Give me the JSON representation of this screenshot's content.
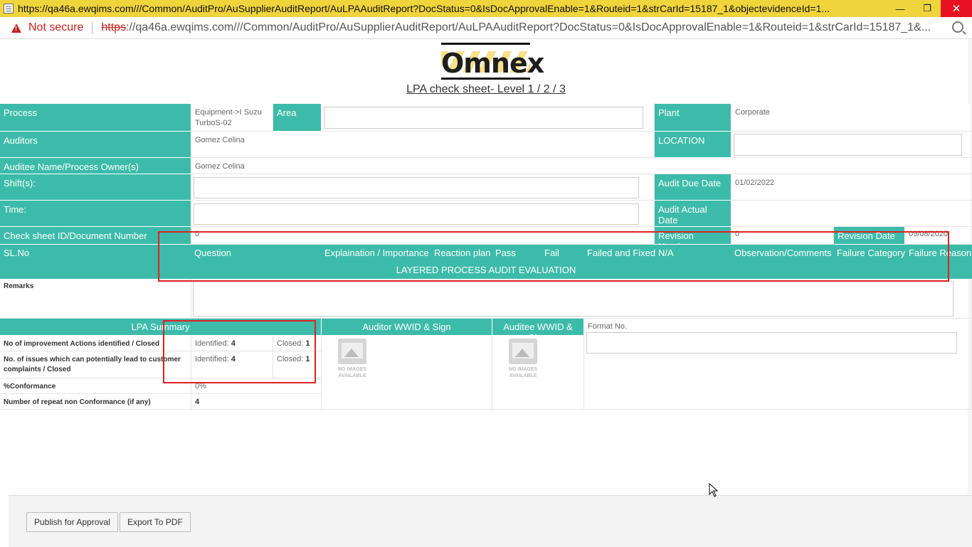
{
  "window": {
    "title": "https://qa46a.ewqims.com///Common/AuditPro/AuSupplierAuditReport/AuLPAAuditReport?DocStatus=0&IsDocApprovalEnable=1&Routeid=1&strCarId=15187_1&objectevidenceId=1...",
    "min_glyph": "—",
    "restore_glyph": "❐",
    "close_glyph": "✕"
  },
  "address": {
    "warning": "Not secure",
    "url_scheme": "https",
    "url_rest": "://qa46a.ewqims.com///Common/AuditPro/AuSupplierAuditReport/AuLPAAuditReport?DocStatus=0&IsDocApprovalEnable=1&Routeid=1&strCarId=15187_1&..."
  },
  "header": {
    "logo_text": "Omnex",
    "title": "LPA check sheet- Level 1 / 2 / 3"
  },
  "form": {
    "process_label": "Process",
    "process_value": "Equipment->I Suzu TurboS-02",
    "area_label": "Area",
    "area_value": "",
    "plant_label": "Plant",
    "plant_value": "Corporate",
    "auditors_label": "Auditors",
    "auditors_value": "Gomez Celina",
    "location_label": "LOCATION",
    "location_value": "",
    "auditee_label": "Auditee Name/Process Owner(s)",
    "auditee_value": "Gomez Celina",
    "shifts_label": "Shift(s):",
    "shifts_value": "",
    "due_date_label": "Audit Due Date",
    "due_date_value": "01/02/2022",
    "time_label": "Time:",
    "time_value": "",
    "actual_date_label": "Audit Actual Date",
    "actual_date_value": "",
    "doc_number_label": "Check sheet ID/Document Number",
    "doc_number_value": "0",
    "revision_number_label": "Revision Number",
    "revision_number_value": "0",
    "revision_date_label": "Revision Date",
    "revision_date_value": "09/08/2020"
  },
  "evaluation_table": {
    "columns": [
      "SL.No",
      "Question",
      "Explaination / Importance",
      "Reaction plan",
      "Pass",
      "Fail",
      "Failed and Fixed",
      "N/A",
      "Observation/Comments",
      "Failure Category",
      "Failure Reason"
    ],
    "section_title": "LAYERED PROCESS AUDIT EVALUATION"
  },
  "remarks": {
    "label": "Remarks",
    "value": ""
  },
  "summary": {
    "title": "LPA Summary",
    "auditor_sign": "Auditor WWID & Sign",
    "auditee_sign": "Auditee WWID & Sign",
    "format_label": "Format No.",
    "format_value": "",
    "rows": [
      {
        "label": "No of improvement Actions identified / Closed",
        "identified_label": "Identified:",
        "identified": "4",
        "closed_label": "Closed:",
        "closed": "1"
      },
      {
        "label": "No. of issues which can potentially lead to customer complaints / Closed",
        "identified_label": "Identified:",
        "identified": "4",
        "closed_label": "Closed:",
        "closed": "1"
      }
    ],
    "conformance_label": "%Conformance",
    "conformance_value": "0%",
    "repeat_label": "Number of repeat non Conformance (if any)",
    "repeat_value": "4",
    "no_image_text": "NO IMAGES AVAILABLE"
  },
  "footer": {
    "publish_label": "Publish for Approval",
    "export_label": "Export To PDF"
  },
  "colors": {
    "teal": "#3dbbaa",
    "titlebar": "#f0d43c",
    "highlight": "#dd2222"
  }
}
